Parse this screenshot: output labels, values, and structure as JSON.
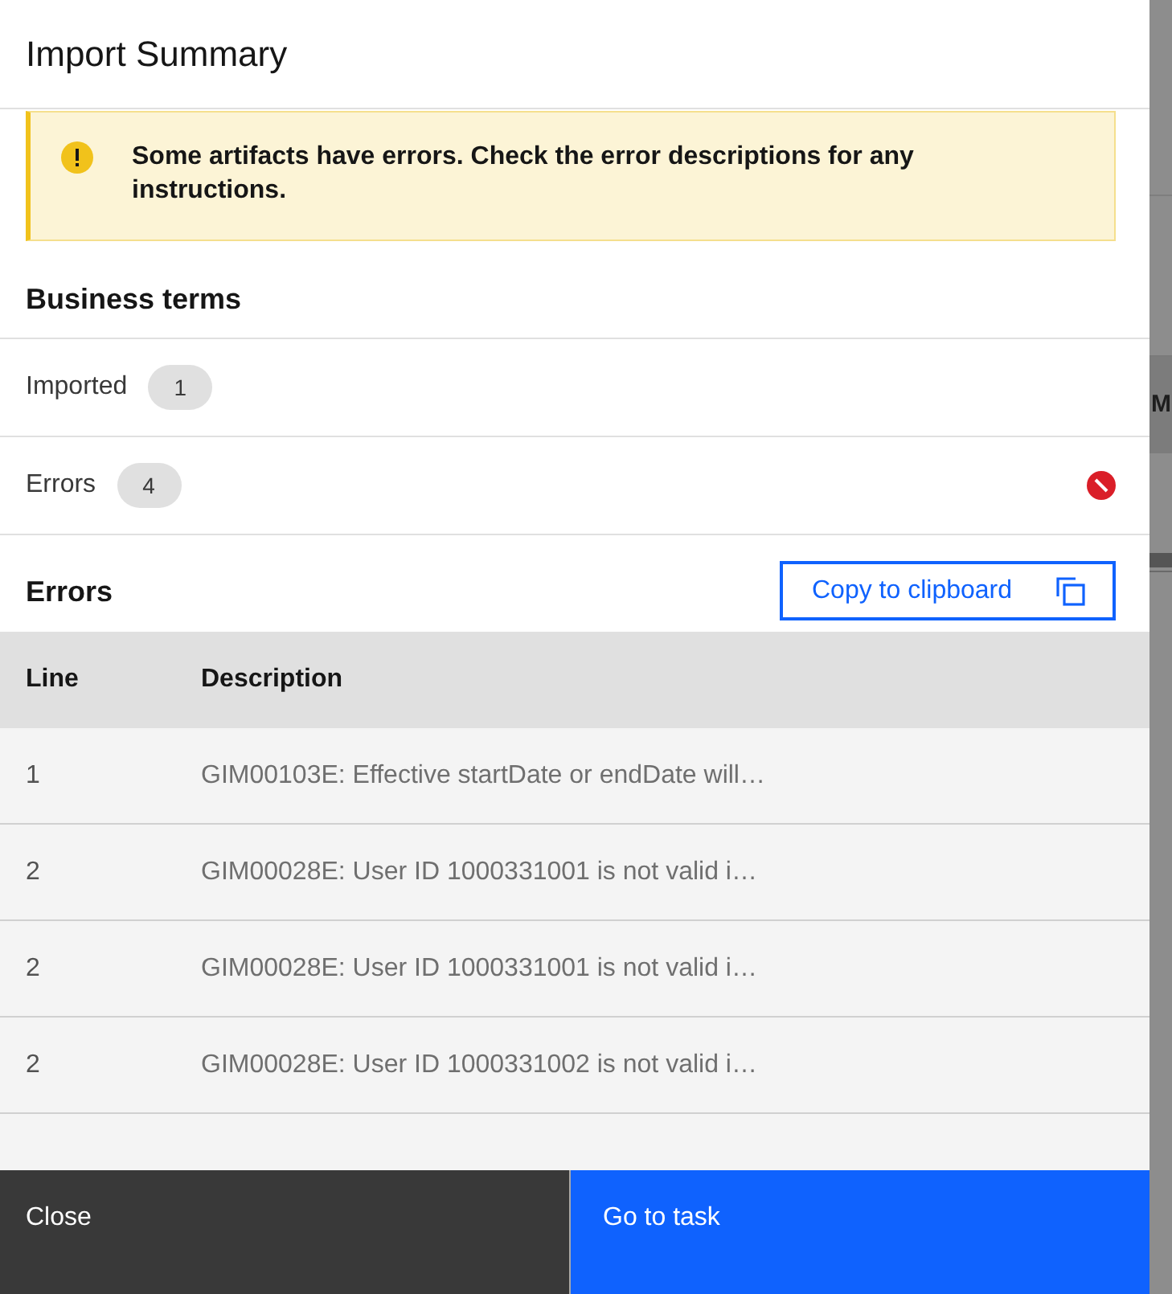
{
  "dialog": {
    "title": "Import Summary"
  },
  "notification": {
    "kind": "warning",
    "message": "Some artifacts have errors. Check the error descriptions for any instructions."
  },
  "summary": {
    "heading": "Business terms",
    "rows": [
      {
        "label": "Imported",
        "count": "1",
        "has_errors": false
      },
      {
        "label": "Errors",
        "count": "4",
        "has_errors": true
      }
    ]
  },
  "errors": {
    "heading": "Errors",
    "copy_button": "Copy to clipboard",
    "table": {
      "columns": [
        "Line",
        "Description"
      ],
      "rows": [
        {
          "line": "1",
          "description": "GIM00103E: Effective startDate or endDate will…"
        },
        {
          "line": "2",
          "description": "GIM00028E: User ID 1000331001 is not valid i…"
        },
        {
          "line": "2",
          "description": "GIM00028E: User ID 1000331001 is not valid i…"
        },
        {
          "line": "2",
          "description": "GIM00028E: User ID 1000331002 is not valid i…"
        }
      ]
    }
  },
  "footer": {
    "buttons": [
      {
        "label": "Close",
        "kind": "secondary"
      },
      {
        "label": "Go to task",
        "kind": "primary"
      }
    ]
  },
  "background_page": {
    "text": "M"
  }
}
